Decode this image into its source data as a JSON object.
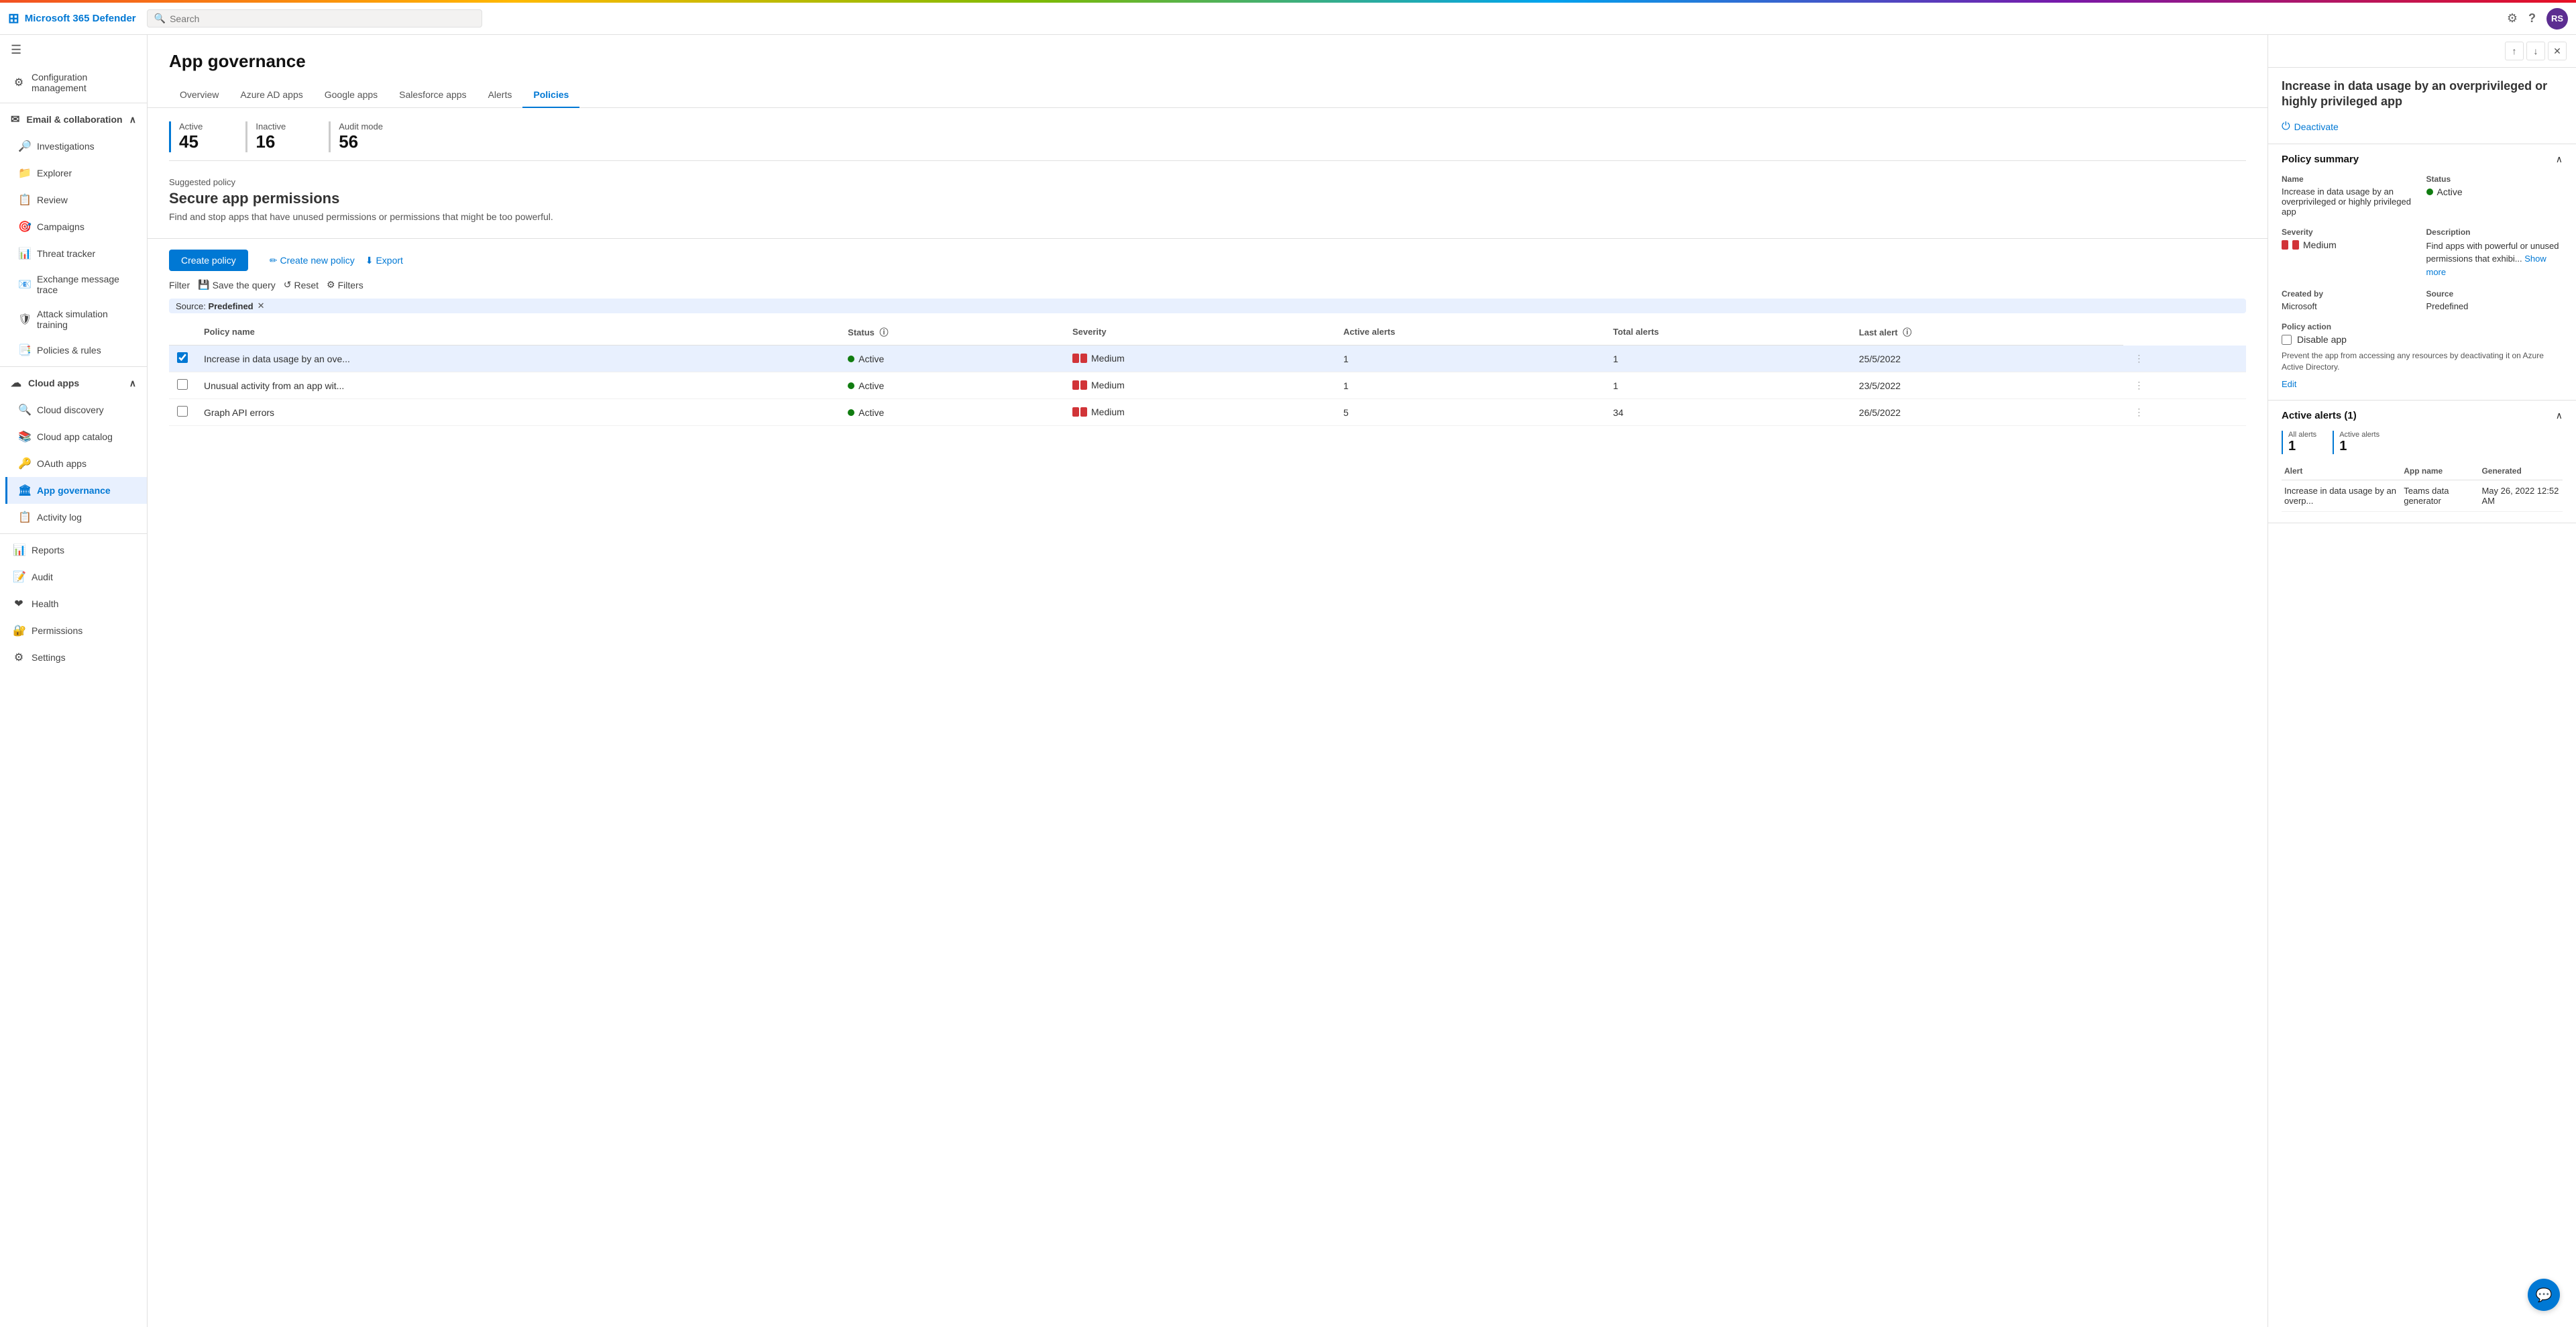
{
  "app": {
    "title": "Microsoft 365 Defender",
    "search_placeholder": "Search"
  },
  "topbar": {
    "title": "Microsoft 365 Defender",
    "avatar": "RS",
    "settings_icon": "⚙",
    "help_icon": "?",
    "search_icon": "🔍"
  },
  "sidebar": {
    "hamburger_icon": "☰",
    "sections": [
      {
        "id": "config",
        "label": "Configuration management",
        "icon": "⚙",
        "expandable": false,
        "active": false
      },
      {
        "id": "email",
        "label": "Email & collaboration",
        "icon": "✉",
        "expandable": true,
        "expanded": true,
        "children": [
          {
            "id": "investigations",
            "label": "Investigations",
            "icon": "🔎",
            "active": false
          },
          {
            "id": "explorer",
            "label": "Explorer",
            "icon": "📁",
            "active": false
          },
          {
            "id": "review",
            "label": "Review",
            "icon": "📋",
            "active": false
          },
          {
            "id": "campaigns",
            "label": "Campaigns",
            "icon": "🎯",
            "active": false
          },
          {
            "id": "threat-tracker",
            "label": "Threat tracker",
            "icon": "📊",
            "active": false
          },
          {
            "id": "exchange-message-trace",
            "label": "Exchange message trace",
            "icon": "📧",
            "active": false
          },
          {
            "id": "attack-simulation-training",
            "label": "Attack simulation training",
            "icon": "🛡",
            "active": false
          },
          {
            "id": "policies-rules",
            "label": "Policies & rules",
            "icon": "📑",
            "active": false
          }
        ]
      },
      {
        "id": "cloud-apps",
        "label": "Cloud apps",
        "icon": "☁",
        "expandable": true,
        "expanded": true,
        "children": [
          {
            "id": "cloud-discovery",
            "label": "Cloud discovery",
            "icon": "🔍",
            "active": false
          },
          {
            "id": "cloud-app-catalog",
            "label": "Cloud app catalog",
            "icon": "📚",
            "active": false
          },
          {
            "id": "oauth-apps",
            "label": "OAuth apps",
            "icon": "🔑",
            "active": false
          },
          {
            "id": "app-governance",
            "label": "App governance",
            "icon": "🏛",
            "active": true
          },
          {
            "id": "activity-log",
            "label": "Activity log",
            "icon": "📋",
            "active": false
          }
        ]
      },
      {
        "id": "reports",
        "label": "Reports",
        "icon": "📊",
        "expandable": false,
        "active": false
      },
      {
        "id": "audit",
        "label": "Audit",
        "icon": "📝",
        "expandable": false,
        "active": false
      },
      {
        "id": "health",
        "label": "Health",
        "icon": "❤",
        "expandable": false,
        "active": false
      },
      {
        "id": "permissions",
        "label": "Permissions",
        "icon": "🔐",
        "expandable": false,
        "active": false
      },
      {
        "id": "settings",
        "label": "Settings",
        "icon": "⚙",
        "expandable": false,
        "active": false
      }
    ]
  },
  "page": {
    "title": "App governance",
    "tabs": [
      {
        "id": "overview",
        "label": "Overview",
        "active": false
      },
      {
        "id": "azure-ad-apps",
        "label": "Azure AD apps",
        "active": false
      },
      {
        "id": "google-apps",
        "label": "Google apps",
        "active": false
      },
      {
        "id": "salesforce-apps",
        "label": "Salesforce apps",
        "active": false
      },
      {
        "id": "alerts",
        "label": "Alerts",
        "active": false
      },
      {
        "id": "policies",
        "label": "Policies",
        "active": true
      }
    ],
    "stats": {
      "active_label": "Active",
      "active_value": "45",
      "inactive_label": "Inactive",
      "inactive_value": "16",
      "audit_label": "Audit mode",
      "audit_value": "56"
    },
    "suggested_policy": {
      "section_label": "Suggested policy",
      "title": "Secure app permissions",
      "description": "Find and stop apps that have unused permissions or permissions that might be too powerful."
    },
    "toolbar": {
      "create_policy_label": "Create policy",
      "create_new_policy_label": "Create new policy",
      "export_label": "Export",
      "filter_label": "Filter",
      "save_query_label": "Save the query",
      "reset_label": "Reset",
      "filters_label": "Filters"
    },
    "filter": {
      "source_label": "Source:",
      "source_value": "Predefined"
    },
    "table": {
      "columns": [
        {
          "id": "policy-name",
          "label": "Policy name"
        },
        {
          "id": "status",
          "label": "Status"
        },
        {
          "id": "severity",
          "label": "Severity"
        },
        {
          "id": "active-alerts",
          "label": "Active alerts"
        },
        {
          "id": "total-alerts",
          "label": "Total alerts"
        },
        {
          "id": "last-alert",
          "label": "Last alert"
        }
      ],
      "rows": [
        {
          "id": 1,
          "selected": true,
          "policy_name": "Increase in data usage by an ove...",
          "status": "Active",
          "severity": "Medium",
          "active_alerts": "1",
          "total_alerts": "1",
          "last_alert": "25/5/2022"
        },
        {
          "id": 2,
          "selected": false,
          "policy_name": "Unusual activity from an app wit...",
          "status": "Active",
          "severity": "Medium",
          "active_alerts": "1",
          "total_alerts": "1",
          "last_alert": "23/5/2022"
        },
        {
          "id": 3,
          "selected": false,
          "policy_name": "Graph API errors",
          "status": "Active",
          "severity": "Medium",
          "active_alerts": "5",
          "total_alerts": "34",
          "last_alert": "26/5/2022"
        }
      ]
    }
  },
  "right_panel": {
    "panel_title": "Increase in data usage by an overprivileged or highly privileged app",
    "deactivate_label": "Deactivate",
    "policy_summary_label": "Policy summary",
    "name_label": "Name",
    "name_value": "Increase in data usage by an overprivileged or highly privileged app",
    "status_label": "Status",
    "status_value": "Active",
    "severity_label": "Severity",
    "severity_value": "Medium",
    "description_label": "Description",
    "description_value": "Find apps with powerful or unused permissions that exhibi...",
    "show_more_label": "Show more",
    "created_by_label": "Created by",
    "created_by_value": "Microsoft",
    "source_label": "Source",
    "source_value": "Predefined",
    "policy_action_label": "Policy action",
    "disable_app_label": "Disable app",
    "disable_app_description": "Prevent the app from accessing any resources by deactivating it on Azure Active Directory.",
    "edit_label": "Edit",
    "active_alerts_label": "Active alerts (1)",
    "all_alerts_label": "All alerts",
    "all_alerts_value": "1",
    "active_alerts_count_label": "Active alerts",
    "active_alerts_count_value": "1",
    "alert_table": {
      "columns": [
        "Alert",
        "App name",
        "Generated"
      ],
      "rows": [
        {
          "alert": "Increase in data usage by an overp...",
          "app_name": "Teams data generator",
          "generated": "May 26, 2022 12:52 AM"
        }
      ]
    }
  }
}
